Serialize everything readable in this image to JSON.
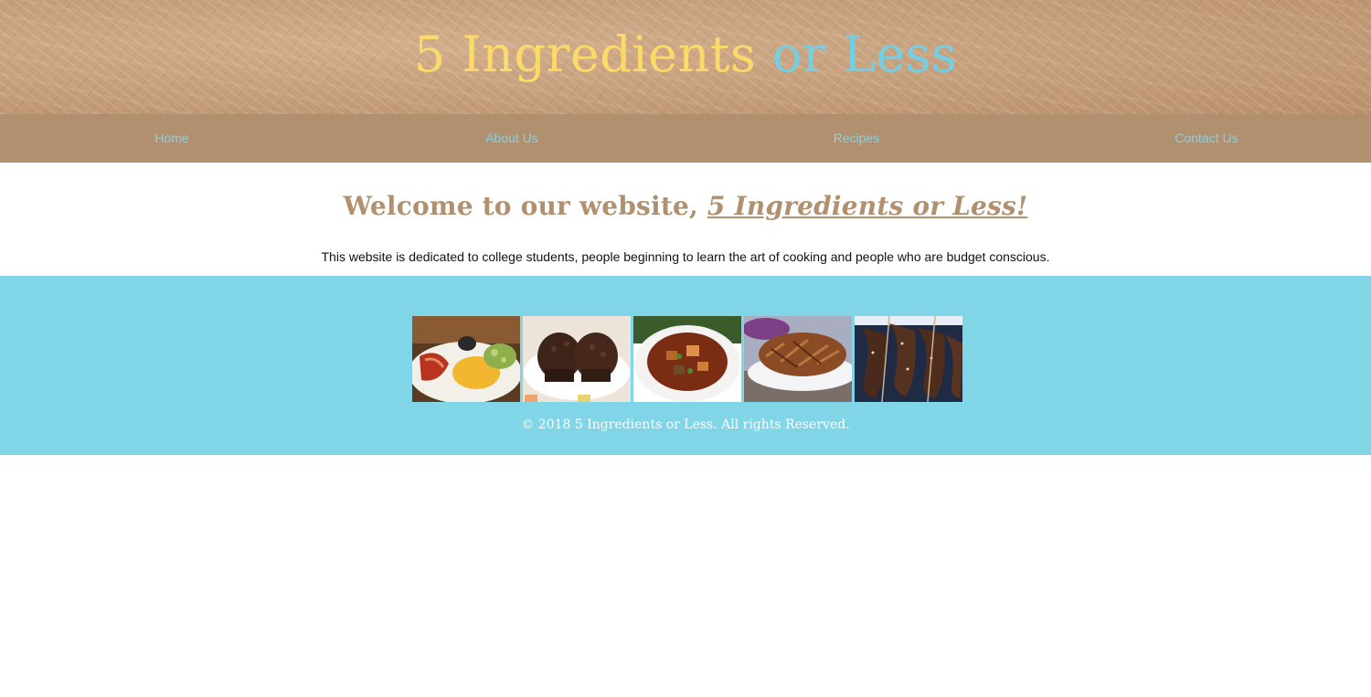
{
  "header": {
    "title_part1": "5 Ingredients",
    "title_part2": "or Less"
  },
  "nav": {
    "items": [
      {
        "label": "Home"
      },
      {
        "label": "About Us"
      },
      {
        "label": "Recipes"
      },
      {
        "label": "Contact Us"
      }
    ]
  },
  "main": {
    "welcome_prefix": "Welcome to our website,",
    "welcome_emph": "5 Ingredients or Less!",
    "intro": "This website is dedicated to college students, people beginning to learn the art of cooking and people who are budget conscious."
  },
  "footer": {
    "gallery": [
      {
        "name": "bacon-eggs-avocado-photo"
      },
      {
        "name": "chocolate-muffins-photo"
      },
      {
        "name": "beef-stew-photo"
      },
      {
        "name": "pulled-pork-photo"
      },
      {
        "name": "chocolate-bananas-photo"
      }
    ],
    "copyright": "© 2018 5 Ingredients or Less. All rights Reserved."
  },
  "colors": {
    "banner": "#c9a27f",
    "nav_bg": "#b1906f",
    "nav_link": "#80d3e8",
    "title_yellow": "#fbd96a",
    "title_blue": "#74cfe2",
    "heading": "#b1906f",
    "footer_bg": "#80d5e7"
  }
}
